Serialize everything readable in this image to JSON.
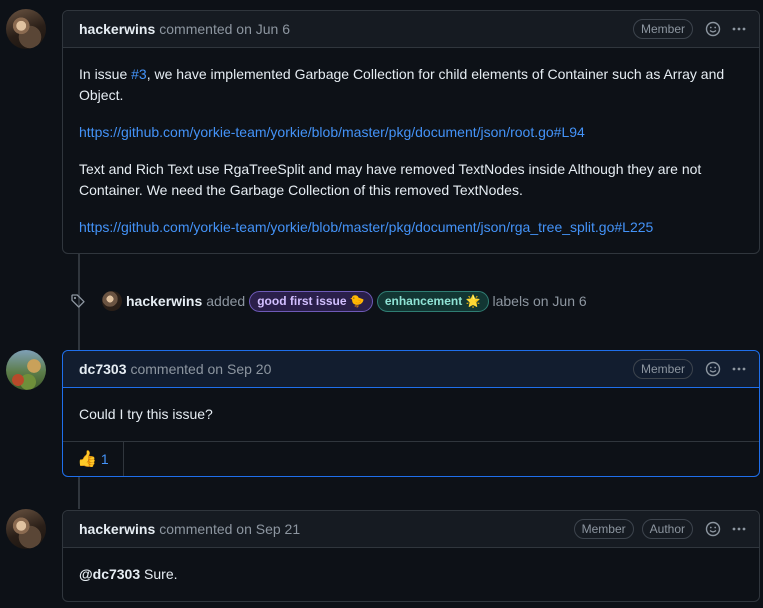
{
  "comments": [
    {
      "author": "hackerwins",
      "meta": "commented on Jun 6",
      "badges": [
        "Member"
      ],
      "body": {
        "p1_prefix": "In issue ",
        "p1_link": "#3",
        "p1_suffix": ", we have implemented Garbage Collection for child elements of Container such as Array and Object.",
        "link1": "https://github.com/yorkie-team/yorkie/blob/master/pkg/document/json/root.go#L94",
        "p2": "Text and Rich Text use RgaTreeSplit and may have removed TextNodes inside Although they are not Container. We need the Garbage Collection of this removed TextNodes.",
        "link2": "https://github.com/yorkie-team/yorkie/blob/master/pkg/document/json/rga_tree_split.go#L225"
      }
    },
    {
      "author": "dc7303",
      "meta": "commented on Sep 20",
      "badges": [
        "Member"
      ],
      "body": {
        "text": "Could I try this issue?"
      },
      "reactions": [
        {
          "emoji": "👍",
          "count": "1"
        }
      ]
    },
    {
      "author": "hackerwins",
      "meta": "commented on Sep 21",
      "badges": [
        "Member",
        "Author"
      ],
      "body": {
        "mention": "@dc7303",
        "text": " Sure."
      }
    }
  ],
  "event": {
    "actor": "hackerwins",
    "action": "added",
    "labels": [
      {
        "name": "good first issue",
        "emoji": "🐤"
      },
      {
        "name": "enhancement",
        "emoji": "🌟"
      }
    ],
    "suffix": "labels on Jun 6"
  },
  "icons": {
    "smiley": "smiley-icon",
    "kebab": "kebab-horizontal-icon",
    "tag": "tag-icon"
  },
  "colors": {
    "link": "#4493f8",
    "highlight_border": "#1f6feb"
  }
}
